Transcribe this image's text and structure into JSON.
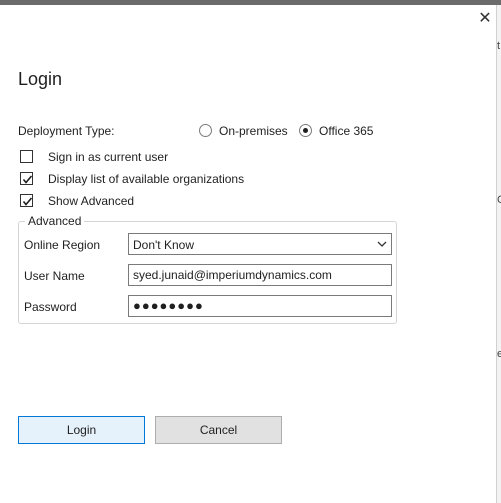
{
  "dialog": {
    "title": "Login",
    "close_glyph": "✕"
  },
  "deployment": {
    "label": "Deployment Type:",
    "options": [
      {
        "label": "On-premises",
        "selected": false
      },
      {
        "label": "Office 365",
        "selected": true
      }
    ]
  },
  "checkboxes": [
    {
      "label": "Sign in as current user",
      "checked": false
    },
    {
      "label": "Display list of available organizations",
      "checked": true
    },
    {
      "label": "Show Advanced",
      "checked": true
    }
  ],
  "advanced": {
    "legend": "Advanced",
    "online_region_label": "Online Region",
    "online_region_value": "Don't Know",
    "user_name_label": "User Name",
    "user_name_value": "syed.junaid@imperiumdynamics.com",
    "password_label": "Password",
    "password_mask": "●●●●●●●●"
  },
  "buttons": {
    "login": "Login",
    "cancel": "Cancel"
  },
  "background_window": {
    "edge_glyphs": [
      "t",
      "C",
      "e"
    ]
  }
}
